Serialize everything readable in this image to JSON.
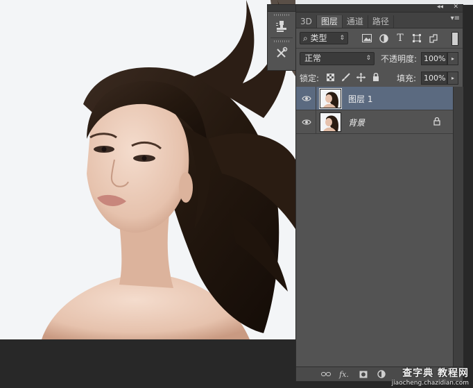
{
  "dock": {
    "tools": [
      {
        "icon": "clone-stamp-icon"
      },
      {
        "icon": "tool-presets-icon"
      }
    ]
  },
  "panel": {
    "collapse_glyph": "◂◂",
    "close_glyph": "✕",
    "tabs": [
      {
        "label": "3D",
        "active": false
      },
      {
        "label": "图层",
        "active": true
      },
      {
        "label": "通道",
        "active": false
      },
      {
        "label": "路径",
        "active": false
      }
    ],
    "menu_glyph": "▾≡",
    "filter": {
      "label": "类型",
      "arrow": "⇕",
      "icons": [
        "image-filter-icon",
        "adjustment-filter-icon",
        "type-filter-icon",
        "shape-filter-icon",
        "smart-object-filter-icon"
      ],
      "type_glyph": "T"
    },
    "blend_mode": {
      "value": "正常",
      "arrow": "⇕"
    },
    "opacity": {
      "label": "不透明度:",
      "value": "100%",
      "button": "▸"
    },
    "lock": {
      "label": "锁定:"
    },
    "fill": {
      "label": "填充:",
      "value": "100%",
      "button": "▸"
    },
    "layers": [
      {
        "name": "图层 1",
        "selected": true,
        "visible": true,
        "locked": false,
        "italic": false
      },
      {
        "name": "背景",
        "selected": false,
        "visible": true,
        "locked": true,
        "italic": true
      }
    ],
    "footer_icons": [
      "link-layers-icon",
      "fx-icon",
      "mask-icon",
      "adjustment-icon",
      "group-icon",
      "new-layer-icon",
      "trash-icon"
    ],
    "fx_label": "fx."
  },
  "watermark": {
    "line1": "查字典 教程网",
    "line2": "jiaocheng.chazidian.com"
  },
  "colors": {
    "panel_bg": "#535353",
    "selected_layer": "#5b6a80",
    "canvas_bg": "#f3f5f7",
    "workspace": "#282828"
  }
}
